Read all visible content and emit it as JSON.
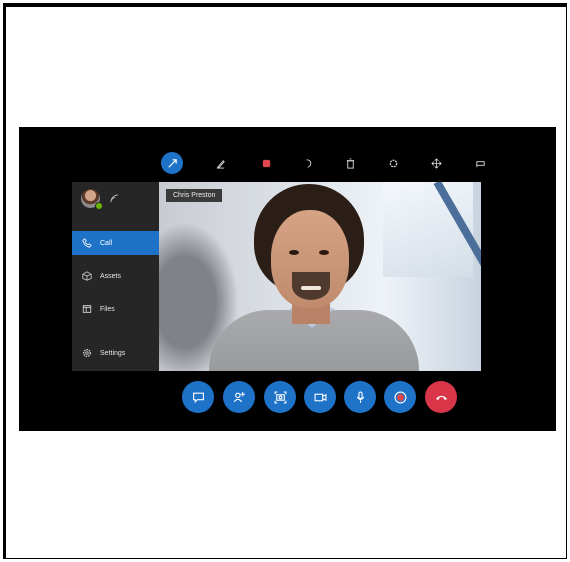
{
  "app": {
    "participant_name": "Chris Preston"
  },
  "toolbar": {
    "tools": [
      {
        "icon": "pointer-icon",
        "active": true
      },
      {
        "icon": "pen-icon",
        "active": false
      },
      {
        "icon": "color-square-icon",
        "active": false
      },
      {
        "icon": "undo-icon",
        "active": false
      },
      {
        "icon": "delete-icon",
        "active": false
      },
      {
        "icon": "settings-icon",
        "active": false
      },
      {
        "icon": "move-icon",
        "active": false
      },
      {
        "icon": "pin-icon",
        "active": false
      }
    ]
  },
  "sidebar": {
    "items": [
      {
        "label": "Call",
        "icon": "phone-icon",
        "active": true
      },
      {
        "label": "Assets",
        "icon": "assets-icon",
        "active": false
      },
      {
        "label": "Files",
        "icon": "files-icon",
        "active": false
      },
      {
        "label": "Settings",
        "icon": "gear-icon",
        "active": false
      }
    ]
  },
  "controls": [
    {
      "icon": "chat-icon"
    },
    {
      "icon": "add-participant-icon"
    },
    {
      "icon": "camera-snapshot-icon"
    },
    {
      "icon": "video-icon"
    },
    {
      "icon": "microphone-icon"
    },
    {
      "icon": "record-icon"
    },
    {
      "icon": "hang-up-icon"
    }
  ],
  "colors": {
    "accent": "#1e73c8",
    "hangup": "#d9364a",
    "panel": "#262626",
    "presence": "#6bb700"
  }
}
